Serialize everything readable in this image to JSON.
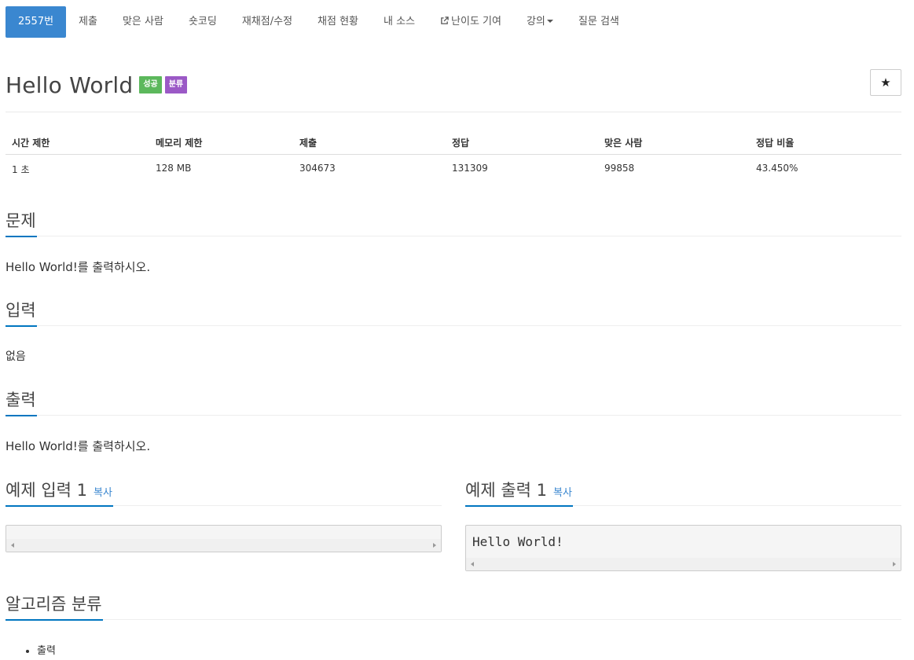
{
  "nav": {
    "items": [
      {
        "label": "2557번",
        "active": true
      },
      {
        "label": "제출"
      },
      {
        "label": "맞은 사람"
      },
      {
        "label": "숏코딩"
      },
      {
        "label": "재채점/수정"
      },
      {
        "label": "채점 현황"
      },
      {
        "label": "내 소스"
      },
      {
        "label": "난이도 기여",
        "icon": "external-link-icon"
      },
      {
        "label": "강의",
        "dropdown": true
      },
      {
        "label": "질문 검색"
      }
    ]
  },
  "problem": {
    "title": "Hello World",
    "badge_success": "성공",
    "badge_category": "분류",
    "star": "★"
  },
  "info": {
    "headers": [
      "시간 제한",
      "메모리 제한",
      "제출",
      "정답",
      "맞은 사람",
      "정답 비율"
    ],
    "values": [
      "1 초",
      "128 MB",
      "304673",
      "131309",
      "99858",
      "43.450%"
    ]
  },
  "sections": {
    "problem_title": "문제",
    "problem_text": "Hello World!를 출력하시오.",
    "input_title": "입력",
    "input_text": "없음",
    "output_title": "출력",
    "output_text": "Hello World!를 출력하시오."
  },
  "samples": {
    "input_title": "예제 입력 1",
    "output_title": "예제 출력 1",
    "copy_label": "복사",
    "input_value": "",
    "output_value": "Hello World!"
  },
  "algorithm": {
    "title": "알고리즘 분류",
    "items": [
      "출력"
    ]
  },
  "colors": {
    "accent": "#3a87d0",
    "success": "#5cb85c",
    "category": "#9b59c6",
    "section_underline": "#0076c0"
  }
}
